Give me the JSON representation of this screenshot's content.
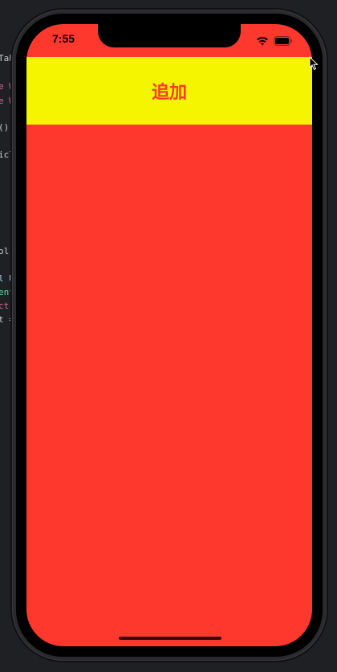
{
  "ide": {
    "fragments": [
      "Tab",
      "e W",
      "e W",
      "()",
      "icl",
      "ol",
      "l Us",
      "ent",
      "ct",
      "t ="
    ]
  },
  "status_bar": {
    "time": "7:55",
    "icons": [
      "signal-wifi-icon",
      "battery-icon"
    ]
  },
  "header": {
    "add_label": "追加"
  },
  "colors": {
    "screen_background": "#ff382e",
    "header_background": "#f5f500",
    "button_text": "#ff382e"
  }
}
